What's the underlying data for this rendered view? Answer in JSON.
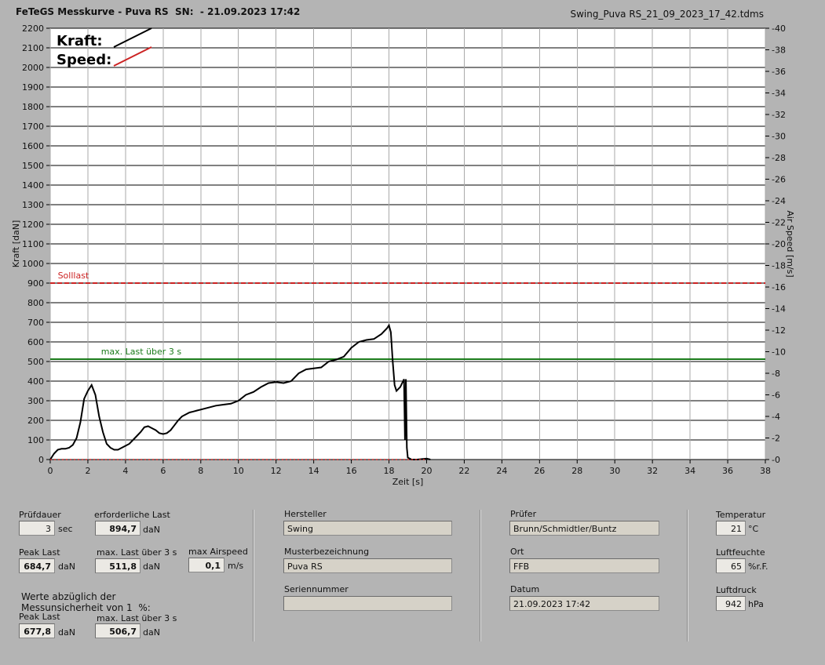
{
  "header": {
    "title": "FeTeGS Messkurve - Puva RS  SN:  - 21.09.2023 17:42",
    "filename": "Swing_Puva RS_21_09_2023_17_42.tdms"
  },
  "colors": {
    "plot_bg": "#ffffff",
    "kraft": "#000000",
    "speed": "#cc2222",
    "solllast": "#cc2222",
    "maxlast": "#1a7a1a",
    "panel_bg": "#b4b4b4"
  },
  "chart_data": {
    "type": "line",
    "xlabel": "Zeit [s]",
    "ylabel": "Kraft [daN]",
    "y2label": "Air Speed [m/s]",
    "xlim": [
      0,
      38
    ],
    "ylim": [
      0,
      2200
    ],
    "y2lim": [
      0,
      40
    ],
    "xticks": [
      0,
      2,
      4,
      6,
      8,
      10,
      12,
      14,
      16,
      18,
      20,
      22,
      24,
      26,
      28,
      30,
      32,
      34,
      36,
      38
    ],
    "yticks": [
      0,
      100,
      200,
      300,
      400,
      500,
      600,
      700,
      800,
      900,
      1000,
      1100,
      1200,
      1300,
      1400,
      1500,
      1600,
      1700,
      1800,
      1900,
      2000,
      2100,
      2200
    ],
    "y2ticks": [
      0,
      2,
      4,
      6,
      8,
      10,
      12,
      14,
      16,
      18,
      20,
      22,
      24,
      26,
      28,
      30,
      32,
      34,
      36,
      38,
      40
    ],
    "grid": true,
    "legend": [
      {
        "name": "Kraft:",
        "color": "#000000"
      },
      {
        "name": "Speed:",
        "color": "#cc2222"
      }
    ],
    "series": [
      {
        "name": "Kraft:",
        "x": [
          0,
          0.2,
          0.4,
          0.6,
          0.8,
          1.0,
          1.2,
          1.4,
          1.6,
          1.8,
          2.0,
          2.2,
          2.4,
          2.6,
          2.8,
          3.0,
          3.2,
          3.4,
          3.6,
          3.8,
          4.0,
          4.2,
          4.4,
          4.6,
          4.8,
          5.0,
          5.2,
          5.4,
          5.6,
          5.8,
          6.0,
          6.2,
          6.4,
          6.6,
          6.8,
          7.0,
          7.2,
          7.4,
          7.6,
          7.8,
          8.0,
          8.4,
          8.8,
          9.2,
          9.6,
          10.0,
          10.4,
          10.8,
          11.2,
          11.6,
          12.0,
          12.4,
          12.8,
          13.2,
          13.6,
          14.0,
          14.4,
          14.8,
          15.2,
          15.6,
          16.0,
          16.4,
          16.8,
          17.2,
          17.6,
          17.9,
          18.0,
          18.1,
          18.2,
          18.3,
          18.4,
          18.6,
          18.8,
          18.85,
          18.9,
          18.95,
          19.0,
          19.1,
          19.2,
          19.5,
          20.0,
          20.2
        ],
        "values": [
          0,
          30,
          50,
          55,
          55,
          60,
          75,
          110,
          190,
          310,
          350,
          380,
          330,
          220,
          140,
          80,
          60,
          50,
          50,
          60,
          70,
          80,
          100,
          120,
          140,
          165,
          170,
          160,
          150,
          135,
          130,
          135,
          150,
          175,
          200,
          220,
          230,
          240,
          245,
          250,
          255,
          265,
          275,
          280,
          285,
          300,
          330,
          345,
          370,
          390,
          395,
          390,
          400,
          440,
          460,
          465,
          470,
          500,
          510,
          525,
          570,
          600,
          610,
          615,
          640,
          670,
          685,
          650,
          500,
          380,
          350,
          370,
          410,
          100,
          410,
          60,
          10,
          5,
          0,
          0,
          5,
          0
        ]
      },
      {
        "name": "Speed:",
        "x": [
          0,
          20
        ],
        "values": [
          0,
          0
        ]
      }
    ],
    "reference_lines": [
      {
        "label": "Solllast",
        "value": 900,
        "color": "#cc2222",
        "style": "dashed"
      },
      {
        "label": "max. Last über  3 s",
        "value": 511.8,
        "color": "#1a7a1a",
        "style": "solid"
      }
    ]
  },
  "panel": {
    "pruefdauer": {
      "label": "Prüfdauer",
      "value": "3",
      "unit": "sec"
    },
    "erf_last": {
      "label": "erforderliche Last",
      "value": "894,7",
      "unit": "daN"
    },
    "peak_last": {
      "label": "Peak Last",
      "value": "684,7",
      "unit": "daN"
    },
    "max_last": {
      "label": "max. Last über  3 s",
      "value": "511,8",
      "unit": "daN"
    },
    "max_airspeed": {
      "label": "max Airspeed",
      "value": "0,1",
      "unit": "m/s"
    },
    "note": "Werte abzüglich der\nMessunsicherheit von 1  %:",
    "peak_last2": {
      "label": "Peak Last",
      "value": "677,8",
      "unit": "daN"
    },
    "max_last2": {
      "label": "max. Last über  3 s",
      "value": "506,7",
      "unit": "daN"
    },
    "hersteller": {
      "label": "Hersteller",
      "value": "Swing"
    },
    "muster": {
      "label": "Musterbezeichnung",
      "value": "Puva RS"
    },
    "serien": {
      "label": "Seriennummer",
      "value": ""
    },
    "pruefer": {
      "label": "Prüfer",
      "value": "Brunn/Schmidtler/Buntz"
    },
    "ort": {
      "label": "Ort",
      "value": "FFB"
    },
    "datum": {
      "label": "Datum",
      "value": "21.09.2023 17:42"
    },
    "temperatur": {
      "label": "Temperatur",
      "value": "21",
      "unit": "°C"
    },
    "luftfeuchte": {
      "label": "Luftfeuchte",
      "value": "65",
      "unit": "%r.F."
    },
    "luftdruck": {
      "label": "Luftdruck",
      "value": "942",
      "unit": "hPa"
    }
  }
}
